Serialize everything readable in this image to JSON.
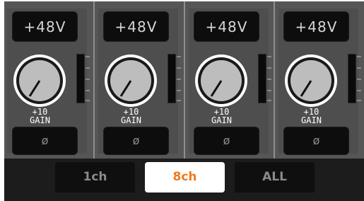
{
  "channels": [
    {
      "phantom_label": "+48V",
      "gain_value": "+10",
      "gain_label": "GAIN",
      "phase_label": "ø"
    },
    {
      "phantom_label": "+48V",
      "gain_value": "+10",
      "gain_label": "GAIN",
      "phase_label": "ø"
    },
    {
      "phantom_label": "+48V",
      "gain_value": "+10",
      "gain_label": "GAIN",
      "phase_label": "ø"
    },
    {
      "phantom_label": "+48V",
      "gain_value": "+10",
      "gain_label": "GAIN",
      "phase_label": "ø"
    }
  ],
  "tabs": [
    {
      "label": "1ch",
      "active": false
    },
    {
      "label": "8ch",
      "active": true
    },
    {
      "label": "ALL",
      "active": false
    }
  ],
  "colors": {
    "active_tab_text": "#f07a1c",
    "panel": "#565656",
    "button": "#0d0d0d"
  },
  "icons": {
    "phase": "phase-invert-icon",
    "knob": "gain-knob-icon"
  }
}
